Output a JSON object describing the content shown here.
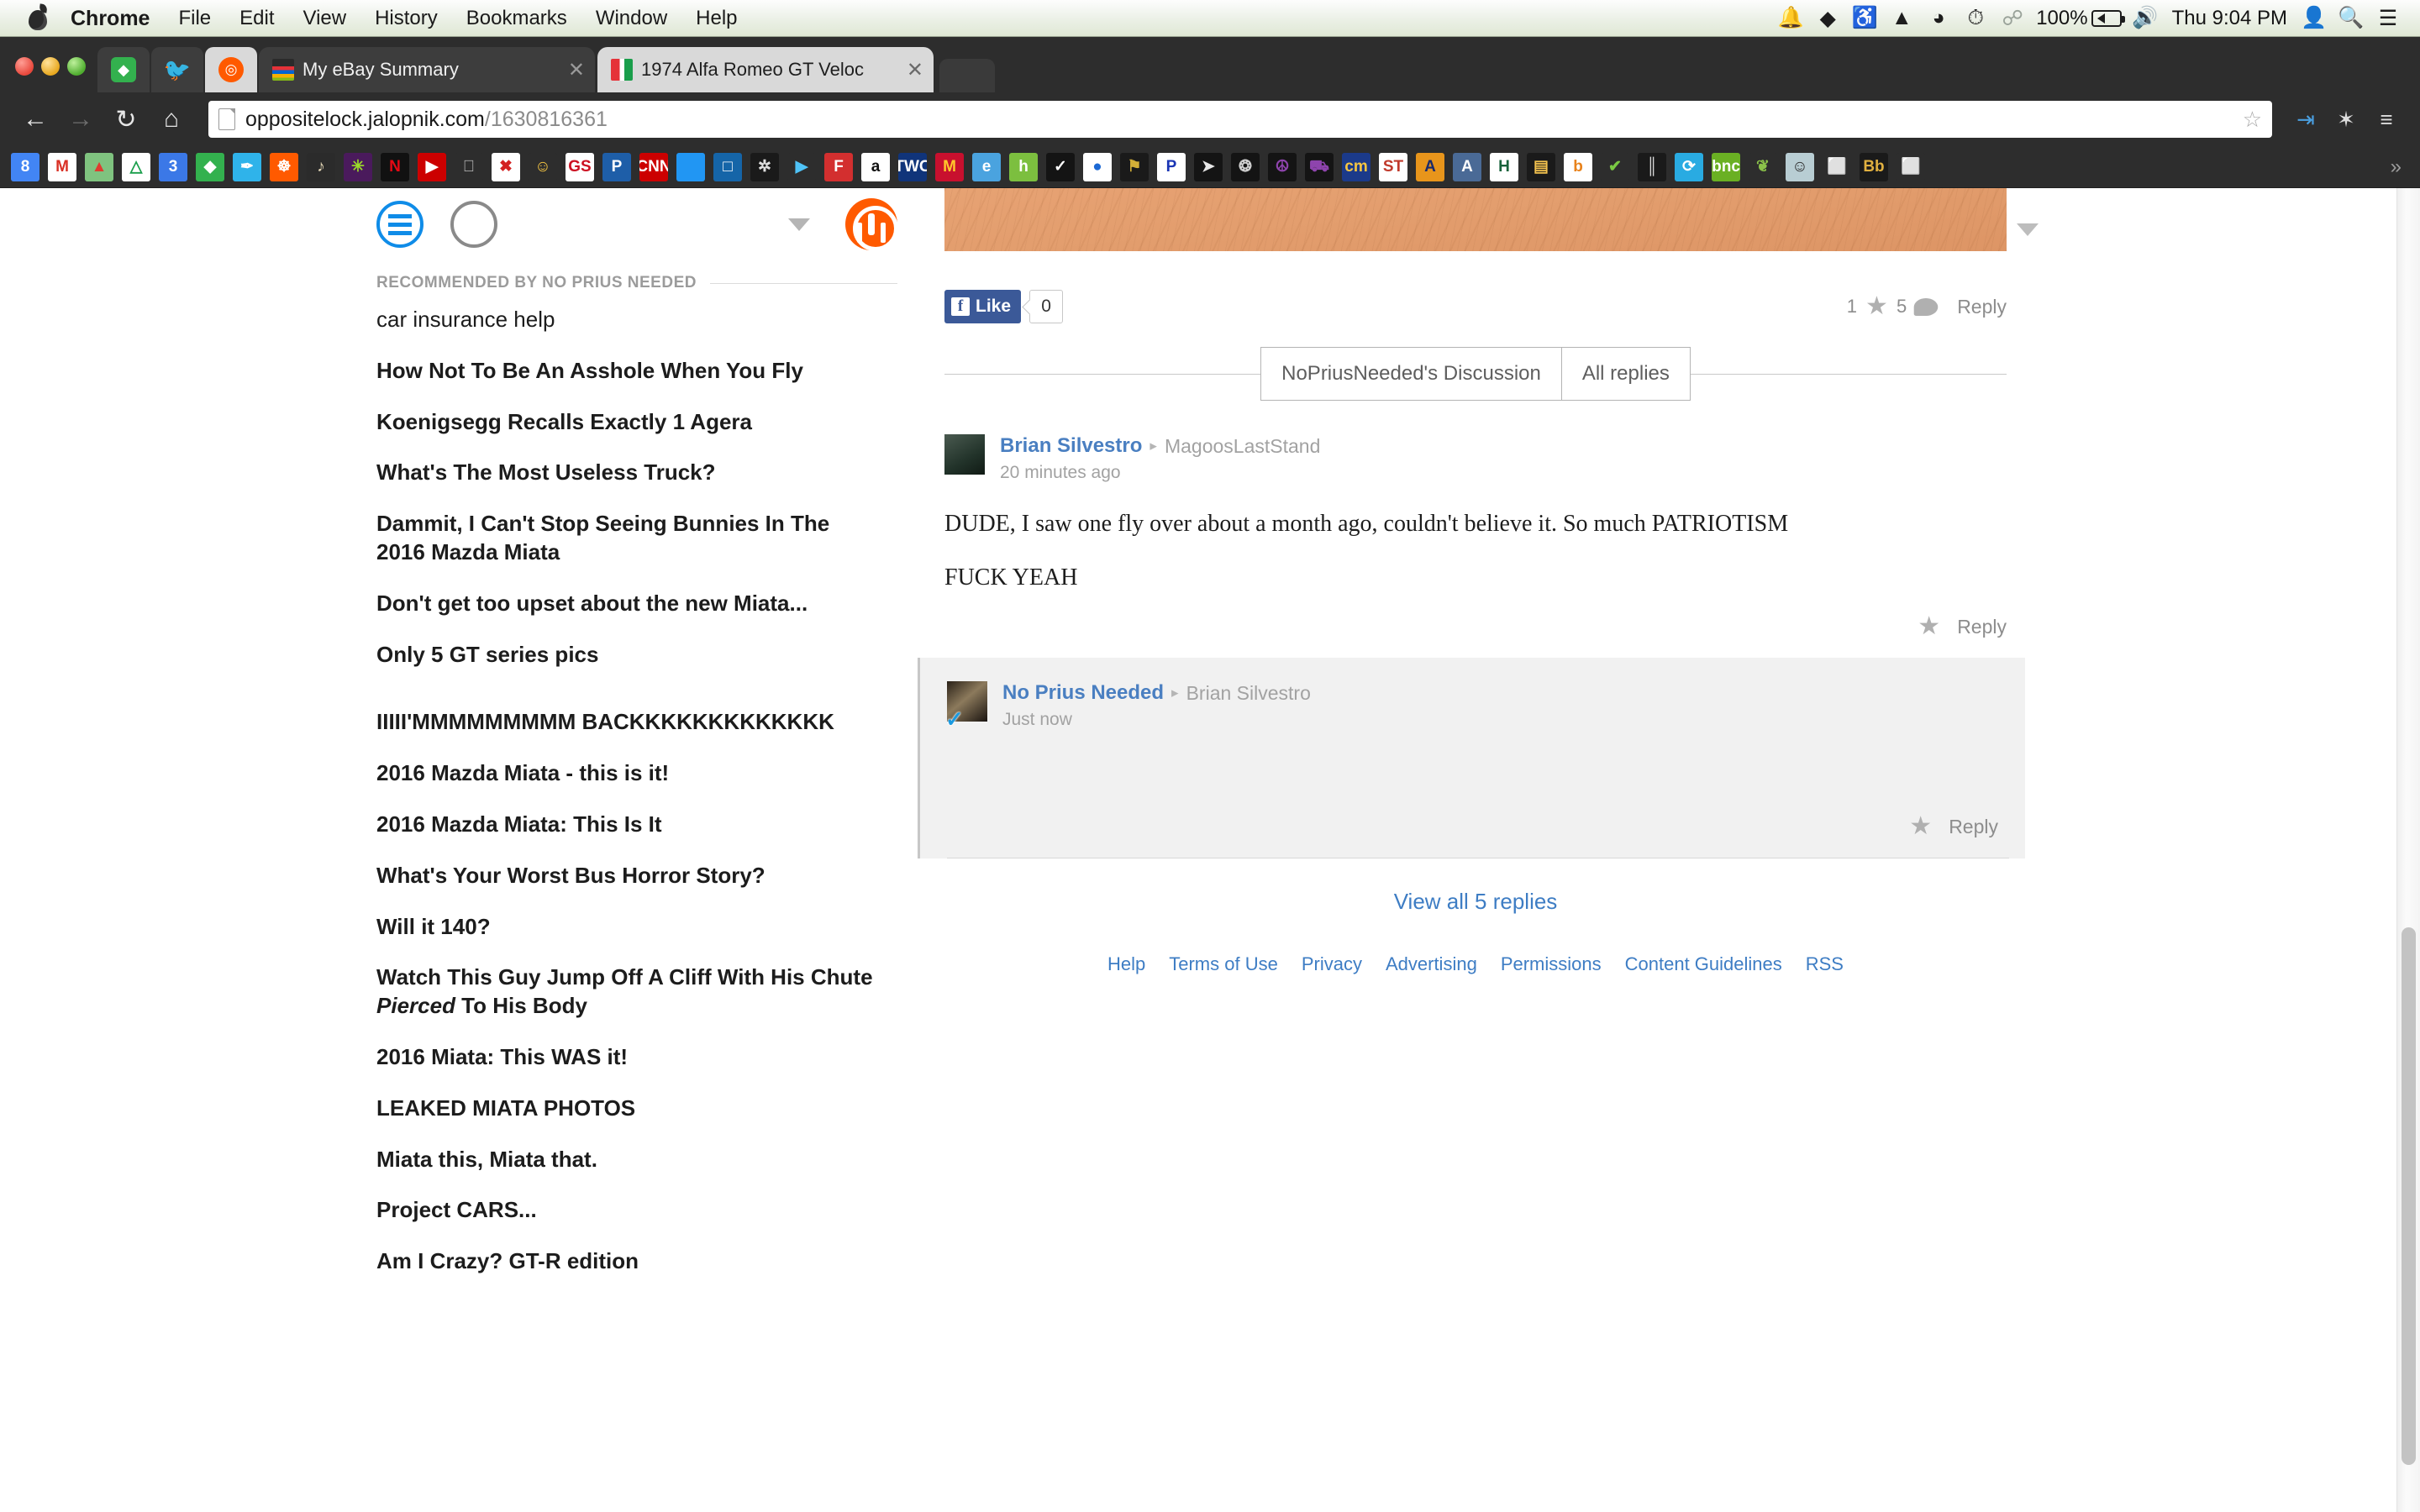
{
  "menubar": {
    "apple_icon": "apple-logo",
    "app_name": "Chrome",
    "items": [
      "File",
      "Edit",
      "View",
      "History",
      "Bookmarks",
      "Window",
      "Help"
    ],
    "status": {
      "battery_percent": "100%",
      "clock": "Thu 9:04 PM",
      "icons": [
        "bell-icon",
        "dropbox-icon",
        "headphones-icon",
        "airplay-icon",
        "wifi-icon",
        "time-machine-icon",
        "bluetooth-icon",
        "battery-icon",
        "volume-icon",
        "user-icon",
        "spotlight-search-icon",
        "notification-center-icon"
      ]
    }
  },
  "browser": {
    "window_controls": [
      "close-button",
      "minimize-button",
      "zoom-button"
    ],
    "pinned_tabs": [
      {
        "name": "feedly-pinned-tab",
        "color": "#33b14e",
        "glyph": "◆"
      },
      {
        "name": "twitter-pinned-tab",
        "color": "#2fb3ea",
        "glyph": "✒"
      },
      {
        "name": "oppositelock-pinned-tab",
        "color": "#ff5a00",
        "glyph": "☸",
        "active": true
      }
    ],
    "tabs": [
      {
        "title": "My eBay Summary",
        "favicon": "ebay-favicon",
        "active": false
      },
      {
        "title": "1974 Alfa Romeo GT Veloc",
        "favicon": "alfa-romeo-favicon",
        "active": true
      }
    ],
    "new_tab_label": "+",
    "toolbar": {
      "back_label": "←",
      "forward_label": "→",
      "reload_label": "↻",
      "home_label": "⌂",
      "url_host": "oppositelock.jalopnik.com",
      "url_path": "/1630816361",
      "bookmark_star": "☆",
      "share_label": "⇥",
      "extension_label": "✦",
      "menu_label": "≡"
    },
    "bookmarks": [
      {
        "name": "google",
        "label": "8",
        "bg": "#4285f4",
        "fg": "#ffffff"
      },
      {
        "name": "gmail",
        "label": "M",
        "bg": "#ffffff",
        "fg": "#d93025"
      },
      {
        "name": "google-maps",
        "label": "▲",
        "bg": "#7fc37f",
        "fg": "#e03b2f"
      },
      {
        "name": "google-drive",
        "label": "△",
        "bg": "#ffffff",
        "fg": "#1a9e4b"
      },
      {
        "name": "google-keep",
        "label": "3",
        "bg": "#3b78e7",
        "fg": "#ffffff"
      },
      {
        "name": "feedly",
        "label": "◆",
        "bg": "#33b14e",
        "fg": "#ffffff"
      },
      {
        "name": "twitter",
        "label": "✒",
        "bg": "#2fb3ea",
        "fg": "#ffffff"
      },
      {
        "name": "oppositelock",
        "label": "☸",
        "bg": "#ff5a00",
        "fg": "#ffffff"
      },
      {
        "name": "music",
        "label": "♪",
        "bg": "#2b2b2b",
        "fg": "#e6d9b8"
      },
      {
        "name": "slack",
        "label": "✳",
        "bg": "#4a1a5c",
        "fg": "#9bdc28"
      },
      {
        "name": "netflix",
        "label": "N",
        "bg": "#111111",
        "fg": "#e50914"
      },
      {
        "name": "youtube",
        "label": "▶",
        "bg": "#cc0000",
        "fg": "#ffffff"
      },
      {
        "name": "apple",
        "label": "",
        "bg": "#2d2d2d",
        "fg": "#bbbbbb"
      },
      {
        "name": "jalopnik",
        "label": "✖",
        "bg": "#ffffff",
        "fg": "#d32020"
      },
      {
        "name": "cartoon",
        "label": "☺",
        "bg": "#2d2d2d",
        "fg": "#f5c542"
      },
      {
        "name": "gs",
        "label": "GS",
        "bg": "#ffffff",
        "fg": "#cc1122"
      },
      {
        "name": "paypal",
        "label": "P",
        "bg": "#1e5ea8",
        "fg": "#ffffff"
      },
      {
        "name": "cnn",
        "label": "CNN",
        "bg": "#cc0000",
        "fg": "#ffffff"
      },
      {
        "name": "blue-tile",
        "label": "",
        "bg": "#2196f3",
        "fg": "#ffffff"
      },
      {
        "name": "chase",
        "label": "□",
        "bg": "#1565a8",
        "fg": "#ffffff"
      },
      {
        "name": "waffle",
        "label": "✲",
        "bg": "#1a1a1a",
        "fg": "#e0e0e0"
      },
      {
        "name": "google-play",
        "label": "▶",
        "bg": "#2d2d2d",
        "fg": "#4fc3f7"
      },
      {
        "name": "fandango",
        "label": "F",
        "bg": "#d32f2f",
        "fg": "#ffffff"
      },
      {
        "name": "amazon",
        "label": "a",
        "bg": "#ffffff",
        "fg": "#111111"
      },
      {
        "name": "twc",
        "label": "TWC",
        "bg": "#10347a",
        "fg": "#ffffff"
      },
      {
        "name": "mcdonalds",
        "label": "M",
        "bg": "#c8102e",
        "fg": "#ffc72c"
      },
      {
        "name": "rss-reader",
        "label": "e",
        "bg": "#4aa3df",
        "fg": "#ffffff"
      },
      {
        "name": "hipchat",
        "label": "h",
        "bg": "#7cbf3f",
        "fg": "#ffffff"
      },
      {
        "name": "nike",
        "label": "✓",
        "bg": "#141414",
        "fg": "#ffffff"
      },
      {
        "name": "bmw",
        "label": "●",
        "bg": "#ffffff",
        "fg": "#1c69d4"
      },
      {
        "name": "porsche",
        "label": "⚑",
        "bg": "#1a1a1a",
        "fg": "#d4af37"
      },
      {
        "name": "parking",
        "label": "P",
        "bg": "#ffffff",
        "fg": "#1a35b4"
      },
      {
        "name": "wing",
        "label": "➤",
        "bg": "#141414",
        "fg": "#e8e8e8"
      },
      {
        "name": "spider",
        "label": "❂",
        "bg": "#141414",
        "fg": "#cfcfcf"
      },
      {
        "name": "peace",
        "label": "☮",
        "bg": "#141414",
        "fg": "#8e44ad"
      },
      {
        "name": "car",
        "label": "⛟",
        "bg": "#141414",
        "fg": "#8e44ad"
      },
      {
        "name": "cm",
        "label": "cm",
        "bg": "#1b3a8a",
        "fg": "#f5c542"
      },
      {
        "name": "st",
        "label": "ST",
        "bg": "#ffffff",
        "fg": "#c0392b"
      },
      {
        "name": "a-orange",
        "label": "A",
        "bg": "#e8951b",
        "fg": "#1a2a6c"
      },
      {
        "name": "a-blue",
        "label": "A",
        "bg": "#4a6a96",
        "fg": "#ffffff"
      },
      {
        "name": "h-green",
        "label": "H",
        "bg": "#ffffff",
        "fg": "#17623b"
      },
      {
        "name": "colorbar",
        "label": "▤",
        "bg": "#1a1a1a",
        "fg": "#f2c14e"
      },
      {
        "name": "bs",
        "label": "b",
        "bg": "#ffffff",
        "fg": "#e8821b"
      },
      {
        "name": "checkmark",
        "label": "✔",
        "bg": "#2d2d2d",
        "fg": "#7ac943"
      },
      {
        "name": "gate",
        "label": "║",
        "bg": "#1a1a1a",
        "fg": "#d8d8d8"
      },
      {
        "name": "lasso",
        "label": "⟳",
        "bg": "#29abe2",
        "fg": "#ffffff"
      },
      {
        "name": "bnc",
        "label": "bnc",
        "bg": "#6ab023",
        "fg": "#ffffff"
      },
      {
        "name": "plant",
        "label": "❦",
        "bg": "#2d2d2d",
        "fg": "#8bc34a"
      },
      {
        "name": "face",
        "label": "☺",
        "bg": "#b8cdd3",
        "fg": "#2d2d2d"
      },
      {
        "name": "blank-doc-1",
        "label": "⬜",
        "bg": "#2d2d2d",
        "fg": "#e8e8e8"
      },
      {
        "name": "blackboard",
        "label": "Bb",
        "bg": "#1a1a1a",
        "fg": "#e0b040"
      },
      {
        "name": "blank-doc-2",
        "label": "⬜",
        "bg": "#2d2d2d",
        "fg": "#e8e8e8"
      }
    ],
    "bookmarks_overflow": "»"
  },
  "sidebar": {
    "hamburger_icon": "hamburger-menu-icon",
    "avatar_icon": "user-avatar-circle-icon",
    "caret_icon": "chevron-down-icon",
    "site_logo_icon": "oppositelock-logo-icon",
    "recommended_label": "RECOMMENDED BY NO PRIUS NEEDED",
    "links": [
      {
        "text": "car insurance help",
        "style": "reg"
      },
      {
        "text": "How Not To Be An Asshole When You Fly",
        "style": "bold"
      },
      {
        "text": "Koenigsegg Recalls Exactly 1 Agera",
        "style": "bold"
      },
      {
        "text": "What's The Most Useless Truck?",
        "style": "bold"
      },
      {
        "text": "Dammit, I Can't Stop Seeing Bunnies In The 2016 Mazda Miata",
        "style": "bold"
      },
      {
        "text": "Don't get too upset about the new Miata...",
        "style": "bold"
      },
      {
        "text": "Only 5 GT series pics",
        "style": "bold"
      },
      {
        "text": "IIIII'MMMMMMMMM BACKKKKKKKKKKKKK",
        "style": "bold",
        "gap_before": true
      },
      {
        "text": "2016 Mazda Miata - this is it!",
        "style": "bold"
      },
      {
        "text": "2016 Mazda Miata: This Is It",
        "style": "bold"
      },
      {
        "text": "What's Your Worst Bus Horror Story?",
        "style": "bold"
      },
      {
        "text": "Will it 140?",
        "style": "bold"
      },
      {
        "text": "Watch This Guy Jump Off A Cliff With His Chute Pierced To His Body",
        "style": "bold",
        "italic_word": "Pierced"
      },
      {
        "text": "2016 Miata: This WAS it!",
        "style": "bold"
      },
      {
        "text": "LEAKED MIATA PHOTOS",
        "style": "bold"
      },
      {
        "text": "Miata this, Miata that.",
        "style": "bold"
      },
      {
        "text": "Project CARS...",
        "style": "bold"
      },
      {
        "text": "Am I Crazy? GT-R edition",
        "style": "bold"
      }
    ]
  },
  "main": {
    "hero_image_name": "wood-texture-photo",
    "collapse_caret_icon": "chevron-down-icon",
    "facebook": {
      "like_label": "Like",
      "f_glyph": "f",
      "count": "0"
    },
    "stats": {
      "star_count": "1",
      "star_icon": "star-icon",
      "comment_count": "5",
      "comment_icon": "speech-bubble-icon",
      "reply_label": "Reply"
    },
    "tabs": [
      {
        "label": "NoPriusNeeded's Discussion",
        "active": true
      },
      {
        "label": "All replies",
        "active": false
      }
    ],
    "comments": [
      {
        "avatar_name": "brian-silvestro-avatar",
        "author": "Brian Silvestro",
        "arrow": "▸",
        "parent": "MagoosLastStand",
        "time": "20 minutes ago",
        "body": [
          "DUDE, I saw one fly over about a month ago, couldn't believe it. So much PATRIOTISM",
          "FUCK YEAH"
        ],
        "star_icon": "star-icon",
        "reply_label": "Reply",
        "highlight": false,
        "verified": false
      },
      {
        "avatar_name": "no-prius-needed-avatar",
        "author": "No Prius Needed",
        "arrow": "▸",
        "parent": "Brian Silvestro",
        "time": "Just now",
        "body": [],
        "star_icon": "star-icon",
        "reply_label": "Reply",
        "highlight": true,
        "verified": true,
        "verified_icon": "blue-check-icon"
      }
    ],
    "view_all_label": "View all 5 replies",
    "footer_links": [
      "Help",
      "Terms of Use",
      "Privacy",
      "Advertising",
      "Permissions",
      "Content Guidelines",
      "RSS"
    ]
  },
  "scrollbar": {
    "name": "vertical-scrollbar"
  },
  "colors": {
    "accent_blue": "#3e7dc4",
    "author_blue": "#4a7fc1",
    "brand_orange": "#ff5a00",
    "facebook_blue": "#3b5998",
    "toggle_blue": "#0f8ce8",
    "chrome_dark": "#2d2d2d",
    "highlight_bg": "#f1f1f1"
  }
}
